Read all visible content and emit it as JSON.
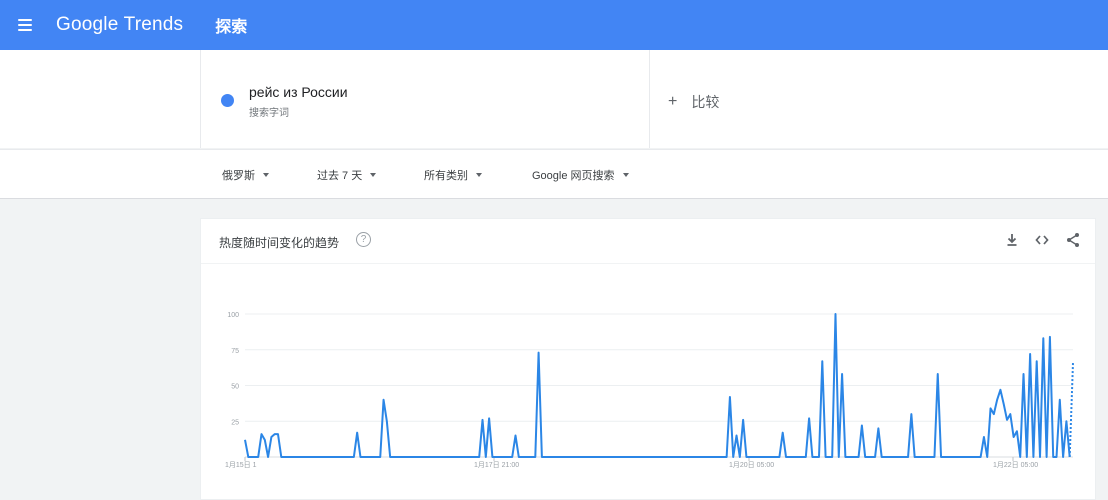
{
  "header": {
    "app_title": "Google Trends",
    "section": "探索"
  },
  "search": {
    "term": "рейс из России",
    "term_type": "搜索字词",
    "term_color": "#4285f4",
    "compare_label": "比较"
  },
  "filters": {
    "region": "俄罗斯",
    "time_range": "过去 7 天",
    "category": "所有类别",
    "property": "Google 网页搜索"
  },
  "card": {
    "title": "热度随时间变化的趋势",
    "help": "?",
    "actions": [
      "download-icon",
      "embed-icon",
      "share-icon"
    ]
  },
  "colors": {
    "brand": "#4285f4",
    "series": "#2b86e6"
  },
  "chart_data": {
    "type": "line",
    "y_ticks": [
      "100",
      "75",
      "50",
      "25"
    ],
    "ylim": [
      0,
      100
    ],
    "x_labels": [
      "1月15日 1",
      "1月17日 21:00",
      "1月20日 05:00",
      "1月22日 05:00"
    ],
    "series": [
      {
        "values": [
          12,
          0,
          0,
          0,
          0,
          16,
          12,
          0,
          14,
          16,
          16,
          0,
          0,
          0,
          0,
          0,
          0,
          0,
          0,
          0,
          0,
          0,
          0,
          0,
          0,
          0,
          0,
          0,
          0,
          0,
          0,
          0,
          0,
          0,
          17,
          0,
          0,
          0,
          0,
          0,
          0,
          0,
          40,
          25,
          0,
          0,
          0,
          0,
          0,
          0,
          0,
          0,
          0,
          0,
          0,
          0,
          0,
          0,
          0,
          0,
          0,
          0,
          0,
          0,
          0,
          0,
          0,
          0,
          0,
          0,
          0,
          0,
          26,
          0,
          27,
          0,
          0,
          0,
          0,
          0,
          0,
          0,
          15,
          0,
          0,
          0,
          0,
          0,
          0,
          73,
          0,
          0,
          0,
          0,
          0,
          0,
          0,
          0,
          0,
          0,
          0,
          0,
          0,
          0,
          0,
          0,
          0,
          0,
          0,
          0,
          0,
          0,
          0,
          0,
          0,
          0,
          0,
          0,
          0,
          0,
          0,
          0,
          0,
          0,
          0,
          0,
          0,
          0,
          0,
          0,
          0,
          0,
          0,
          0,
          0,
          0,
          0,
          0,
          0,
          0,
          0,
          0,
          0,
          0,
          0,
          0,
          0,
          42,
          0,
          15,
          0,
          26,
          0,
          0,
          0,
          0,
          0,
          0,
          0,
          0,
          0,
          0,
          0,
          17,
          0,
          0,
          0,
          0,
          0,
          0,
          0,
          27,
          0,
          0,
          0,
          67,
          0,
          0,
          0,
          100,
          0,
          58,
          0,
          0,
          0,
          0,
          0,
          22,
          0,
          0,
          0,
          0,
          20,
          0,
          0,
          0,
          0,
          0,
          0,
          0,
          0,
          0,
          30,
          0,
          0,
          0,
          0,
          0,
          0,
          0,
          58,
          0,
          0,
          0,
          0,
          0,
          0,
          0,
          0,
          0,
          0,
          0,
          0,
          0,
          14,
          0,
          34,
          30,
          40,
          47,
          37,
          26,
          30,
          14,
          18,
          0,
          58,
          0,
          72,
          0,
          67,
          0,
          83,
          0,
          84,
          0,
          0,
          40,
          0,
          25,
          0,
          66
        ],
        "partial_last": true
      }
    ]
  }
}
